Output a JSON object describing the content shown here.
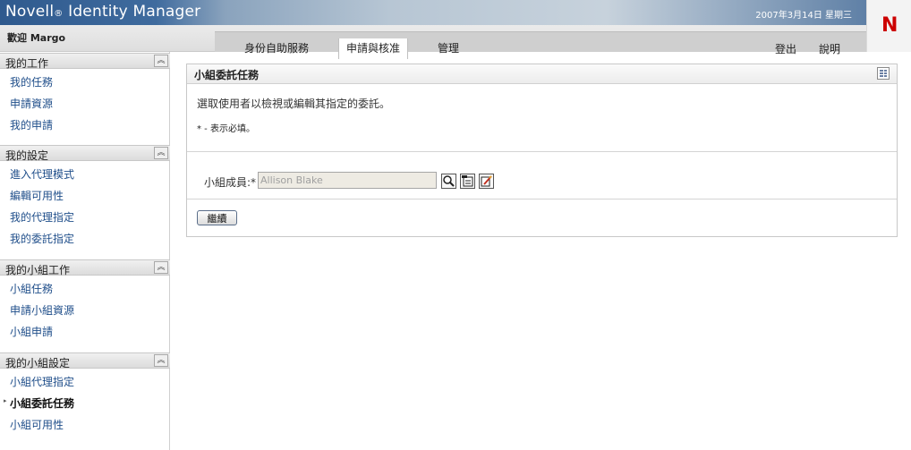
{
  "header": {
    "app_title_prefix": "Novell",
    "app_title_reg": "®",
    "app_title_suffix": " Identity Manager",
    "date": "2007年3月14日 星期三",
    "welcome": "歡迎 Margo",
    "logo_letter": "N"
  },
  "tabs": [
    {
      "label": "身份自助服務",
      "active": false
    },
    {
      "label": "申請與核准",
      "active": true
    },
    {
      "label": "管理",
      "active": false
    }
  ],
  "toolbar": {
    "logout_label": "登出",
    "help_label": "說明"
  },
  "sidebar": {
    "groups": [
      {
        "title": "我的工作",
        "items": [
          "我的任務",
          "申請資源",
          "我的申請"
        ]
      },
      {
        "title": "我的設定",
        "items": [
          "進入代理模式",
          "編輯可用性",
          "我的代理指定",
          "我的委託指定"
        ]
      },
      {
        "title": "我的小組工作",
        "items": [
          "小組任務",
          "申請小組資源",
          "小組申請"
        ]
      },
      {
        "title": "我的小組設定",
        "items": [
          "小組代理指定",
          "小組委託任務",
          "小組可用性"
        ],
        "active_index": 1
      }
    ],
    "collapse_glyph": "︽",
    "active_marker": "▸"
  },
  "main": {
    "panel_title": "小組委託任務",
    "instruction": "選取使用者以檢視或編輯其指定的委託。",
    "required_note": "* - 表示必填。",
    "member_label": "小組成員:*",
    "member_value": "Allison Blake",
    "continue_label": "繼續"
  }
}
